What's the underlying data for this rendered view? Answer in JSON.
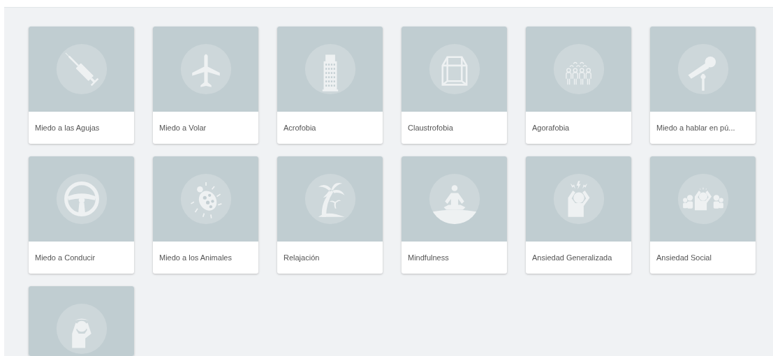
{
  "cards": [
    {
      "title": "Miedo a las Agujas",
      "kind": "syringe"
    },
    {
      "title": "Miedo a Volar",
      "kind": "airplane"
    },
    {
      "title": "Acrofobia",
      "kind": "building"
    },
    {
      "title": "Claustrofobia",
      "kind": "cube"
    },
    {
      "title": "Agorafobia",
      "kind": "crowd"
    },
    {
      "title": "Miedo a hablar en pú...",
      "kind": "microphone"
    },
    {
      "title": "Miedo a Conducir",
      "kind": "wheel"
    },
    {
      "title": "Miedo a los Animales",
      "kind": "ladybug"
    },
    {
      "title": "Relajación",
      "kind": "palm"
    },
    {
      "title": "Mindfulness",
      "kind": "meditation"
    },
    {
      "title": "Ansiedad Generalizada",
      "kind": "stress"
    },
    {
      "title": "Ansiedad Social",
      "kind": "group"
    },
    {
      "kind": "headache"
    }
  ]
}
